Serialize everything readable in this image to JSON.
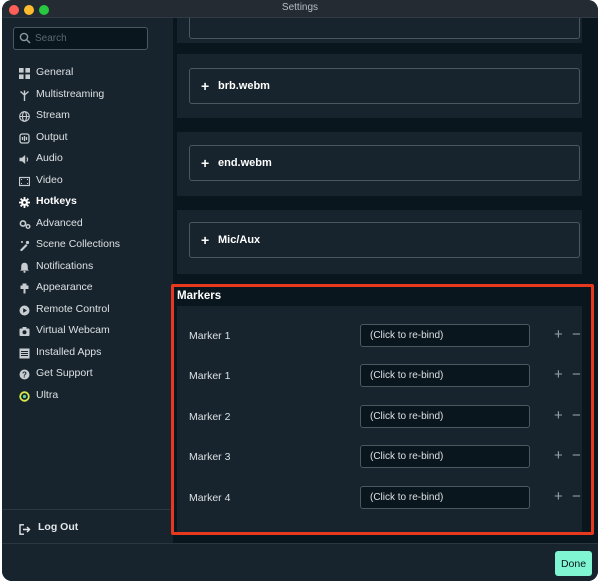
{
  "window": {
    "title": "Settings"
  },
  "search": {
    "placeholder": "Search",
    "value": ""
  },
  "sidebar": {
    "items": [
      {
        "label": "General",
        "icon": "grid-icon"
      },
      {
        "label": "Multistreaming",
        "icon": "fork-icon"
      },
      {
        "label": "Stream",
        "icon": "globe-icon"
      },
      {
        "label": "Output",
        "icon": "output-icon"
      },
      {
        "label": "Audio",
        "icon": "speaker-icon"
      },
      {
        "label": "Video",
        "icon": "film-icon"
      },
      {
        "label": "Hotkeys",
        "icon": "gear-icon",
        "active": true
      },
      {
        "label": "Advanced",
        "icon": "gears-icon"
      },
      {
        "label": "Scene Collections",
        "icon": "collections-icon"
      },
      {
        "label": "Notifications",
        "icon": "bell-icon"
      },
      {
        "label": "Appearance",
        "icon": "palette-icon"
      },
      {
        "label": "Remote Control",
        "icon": "play-circle-icon"
      },
      {
        "label": "Virtual Webcam",
        "icon": "camera-icon"
      },
      {
        "label": "Installed Apps",
        "icon": "apps-icon"
      },
      {
        "label": "Get Support",
        "icon": "question-icon"
      },
      {
        "label": "Ultra",
        "icon": "ultra-icon"
      }
    ],
    "logout": {
      "label": "Log Out",
      "icon": "logout-icon"
    }
  },
  "sources": [
    {
      "label": "brb.webm"
    },
    {
      "label": "end.webm"
    },
    {
      "label": "Mic/Aux"
    }
  ],
  "markers": {
    "title": "Markers",
    "rows": [
      {
        "label": "Marker 1",
        "binding": "(Click to re-bind)"
      },
      {
        "label": "Marker 1",
        "binding": "(Click to re-bind)"
      },
      {
        "label": "Marker 2",
        "binding": "(Click to re-bind)"
      },
      {
        "label": "Marker 3",
        "binding": "(Click to re-bind)"
      },
      {
        "label": "Marker 4",
        "binding": "(Click to re-bind)"
      }
    ],
    "add_symbol": "+",
    "remove_symbol": "−"
  },
  "footer": {
    "done_label": "Done"
  },
  "colors": {
    "accent": "#80f5d2",
    "highlight": "#e8391f",
    "background": "#09161d",
    "panel": "#17242d"
  }
}
